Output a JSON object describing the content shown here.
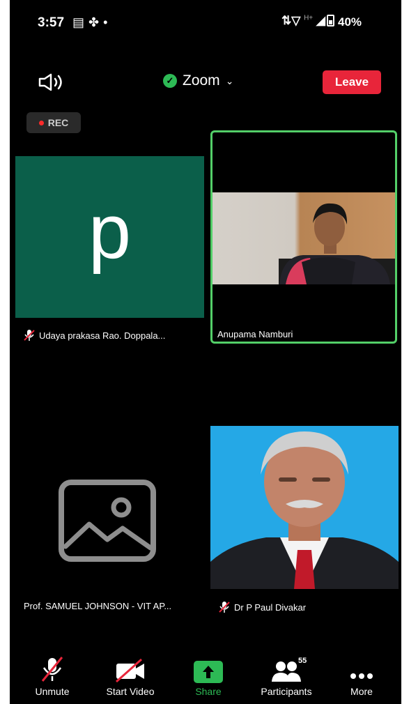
{
  "status_bar": {
    "time": "3:57",
    "network": "H+",
    "battery": "40%"
  },
  "header": {
    "title": "Zoom",
    "leave_label": "Leave",
    "rec_label": "REC"
  },
  "tiles": [
    {
      "initial": "p",
      "name": "Udaya prakasa Rao. Doppala...",
      "muted": true
    },
    {
      "name": "Anupama Namburi",
      "muted": false,
      "active_speaker": true
    },
    {
      "name": "Prof. SAMUEL JOHNSON - VIT AP...",
      "muted": false
    },
    {
      "name": "Dr P Paul Divakar",
      "muted": true
    }
  ],
  "toolbar": {
    "unmute": "Unmute",
    "start_video": "Start Video",
    "share": "Share",
    "participants": "Participants",
    "participants_count": "55",
    "more": "More"
  },
  "colors": {
    "leave": "#e8253a",
    "share": "#2dba55",
    "active_border": "#53cf68",
    "tile_bg": "#0b5f4a"
  }
}
